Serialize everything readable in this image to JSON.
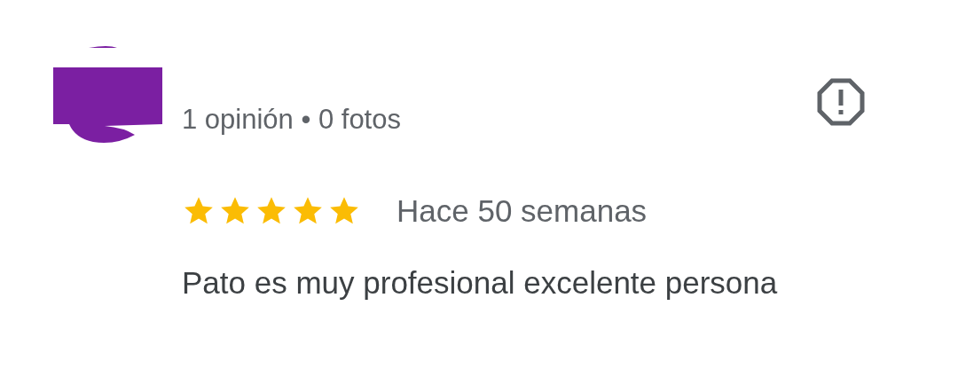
{
  "reviewer": {
    "meta": "1 opinión • 0 fotos"
  },
  "review": {
    "stars": 5,
    "time": "Hace 50 semanas",
    "text": "Pato es muy profesional excelente persona"
  }
}
